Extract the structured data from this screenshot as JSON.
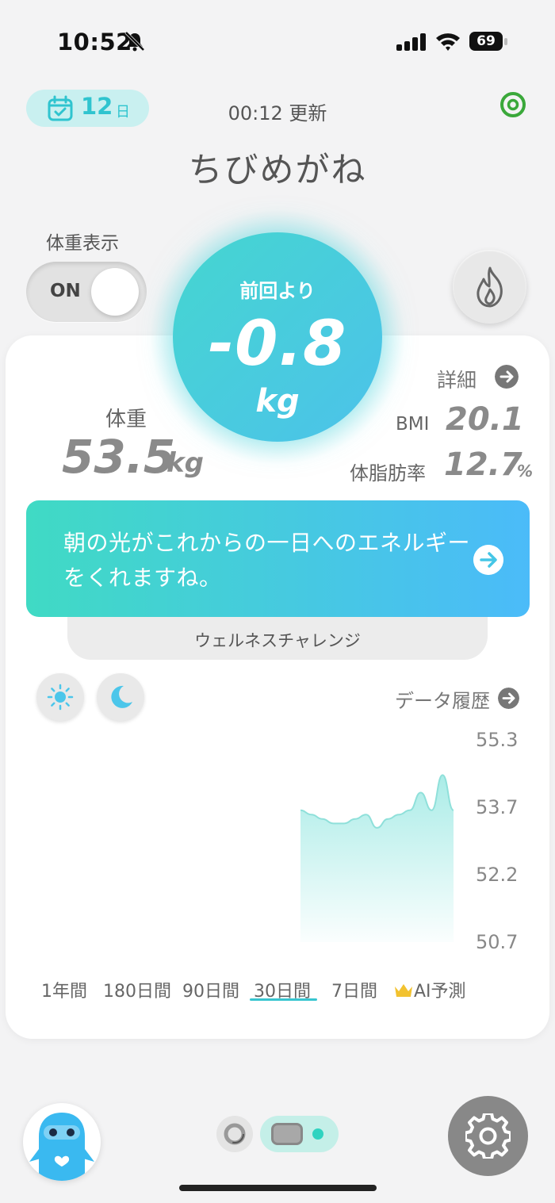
{
  "status_bar": {
    "time": "10:52",
    "battery": "69"
  },
  "header": {
    "days_num": "12",
    "days_unit": "日",
    "update_time": "00:12 更新",
    "name": "ちびめがね"
  },
  "weight_display": {
    "label": "体重表示",
    "toggle": "ON"
  },
  "change": {
    "label": "前回より",
    "value": "-0.8",
    "unit": "kg"
  },
  "stats": {
    "weight_label": "体重",
    "weight_value": "53.5",
    "weight_unit": "kg",
    "detail": "詳細",
    "bmi_label": "BMI",
    "bmi_value": "20.1",
    "fat_label": "体脂肪率",
    "fat_value": "12.7",
    "fat_unit": "%"
  },
  "banner": {
    "message": "朝の光がこれからの一日へのエネルギーをくれますね。",
    "tab_label": "ウェルネスチャレンジ"
  },
  "history": {
    "label": "データ履歴"
  },
  "chart_data": {
    "type": "area",
    "yticks": [
      "55.3",
      "53.7",
      "52.2",
      "50.7"
    ],
    "ylim": [
      50.7,
      55.3
    ],
    "fill_color": "#a6ebe6",
    "series": [
      {
        "values": [
          53.7,
          53.6,
          53.5,
          53.4,
          53.4,
          53.5,
          53.6,
          53.3,
          53.5,
          53.6,
          53.7,
          54.1,
          53.7,
          54.5,
          53.7
        ]
      }
    ]
  },
  "ranges": {
    "tabs": [
      "1年間",
      "180日間",
      "90日間",
      "30日間",
      "7日間",
      "AI予測"
    ],
    "selected": "30日間"
  },
  "colors": {
    "accent": "#38c5d0",
    "banner_start": "#40dac4",
    "banner_end": "#4bbbf9"
  }
}
